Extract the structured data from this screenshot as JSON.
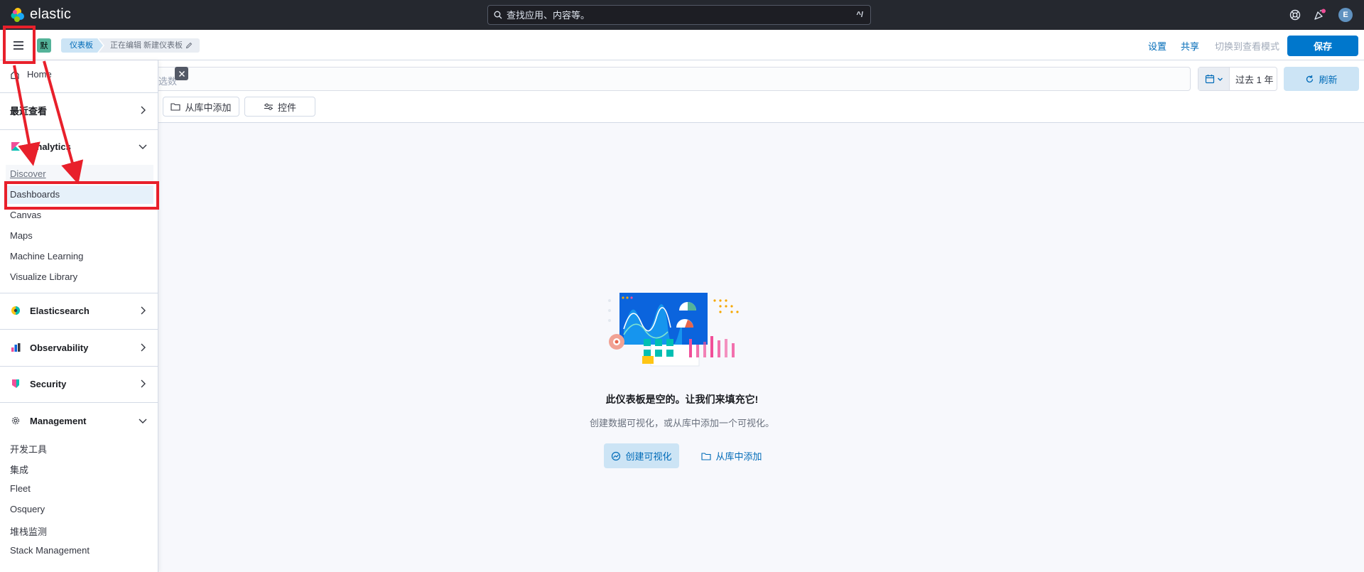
{
  "header": {
    "brand": "elastic",
    "search_placeholder": "查找应用、内容等。",
    "search_shortcut": "^/",
    "avatar_initial": "E"
  },
  "appbar": {
    "space_initial": "默",
    "breadcrumbs": [
      "仪表板",
      "正在编辑 新建仪表板"
    ],
    "settings": "设置",
    "share": "共享",
    "switch_view": "切换到查看模式",
    "save": "保存"
  },
  "querybar": {
    "filter_placeholder_fragment": "选数",
    "date_range": "过去 1 年",
    "refresh": "刷新",
    "add_from_library": "从库中添加",
    "controls": "控件"
  },
  "sidenav": {
    "home": "Home",
    "recent": "最近查看",
    "analytics": {
      "label": "Analytics",
      "items": [
        "Discover",
        "Dashboards",
        "Canvas",
        "Maps",
        "Machine Learning",
        "Visualize Library"
      ]
    },
    "elasticsearch": "Elasticsearch",
    "observability": "Observability",
    "security": "Security",
    "management": {
      "label": "Management",
      "items": [
        "开发工具",
        "集成",
        "Fleet",
        "Osquery",
        "堆栈监测",
        "Stack Management"
      ]
    }
  },
  "empty_state": {
    "title": "此仪表板是空的。让我们来填充它!",
    "description": "创建数据可视化，或从库中添加一个可视化。",
    "create_button": "创建可视化",
    "add_button": "从库中添加"
  },
  "colors": {
    "header_bg": "#25282f",
    "primary": "#0077cc",
    "annotation_red": "#e8202b",
    "highlight": "#e6f1fa"
  }
}
